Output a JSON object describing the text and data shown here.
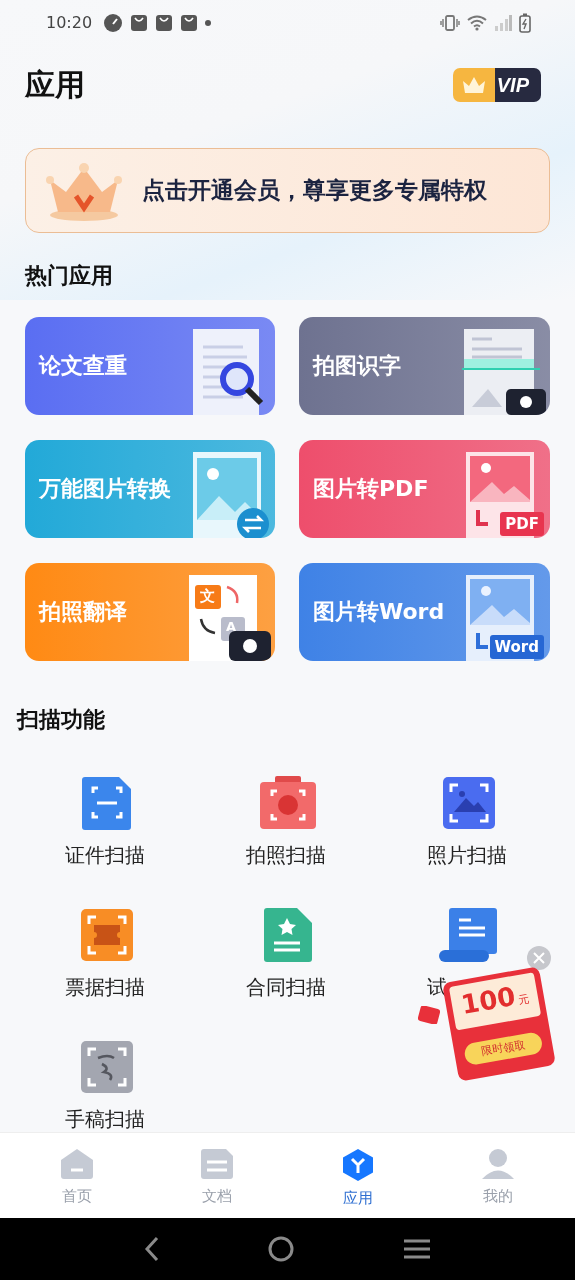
{
  "status_bar": {
    "time": "10:20"
  },
  "header": {
    "title": "应用",
    "vip_badge": "VIP"
  },
  "banner": {
    "text": "点击开通会员，尊享更多专属特权"
  },
  "hot_apps": {
    "title": "热门应用",
    "items": [
      {
        "label": "论文查重",
        "kind": "check",
        "color": "#5a6ef2"
      },
      {
        "label": "拍图识字",
        "kind": "ocr",
        "color": "#6e7290"
      },
      {
        "label": "万能图片转换",
        "kind": "convert",
        "color": "#22a9d8"
      },
      {
        "label": "图片转PDF",
        "kind": "pdf",
        "color": "#ee4e6c",
        "tag": "PDF"
      },
      {
        "label": "拍照翻译",
        "kind": "translate",
        "color": "#ff8a14",
        "tags": [
          "文",
          "A"
        ]
      },
      {
        "label": "图片转Word",
        "kind": "word",
        "color": "#3f82e6",
        "tag": "Word"
      }
    ]
  },
  "scan_functions": {
    "title": "扫描功能",
    "items": [
      {
        "label": "证件扫描",
        "kind": "id"
      },
      {
        "label": "拍照扫描",
        "kind": "camera"
      },
      {
        "label": "照片扫描",
        "kind": "photo"
      },
      {
        "label": "票据扫描",
        "kind": "receipt"
      },
      {
        "label": "合同扫描",
        "kind": "contract"
      },
      {
        "label": "试",
        "kind": "exam"
      },
      {
        "label": "手稿扫描",
        "kind": "manuscript"
      }
    ]
  },
  "promo_popup": {
    "amount": "100",
    "unit": "元",
    "button": "限时领取"
  },
  "bottom_nav": [
    {
      "label": "首页",
      "kind": "home",
      "selected": false
    },
    {
      "label": "文档",
      "kind": "docs",
      "selected": false
    },
    {
      "label": "应用",
      "kind": "apps",
      "selected": true
    },
    {
      "label": "我的",
      "kind": "me",
      "selected": false
    }
  ]
}
